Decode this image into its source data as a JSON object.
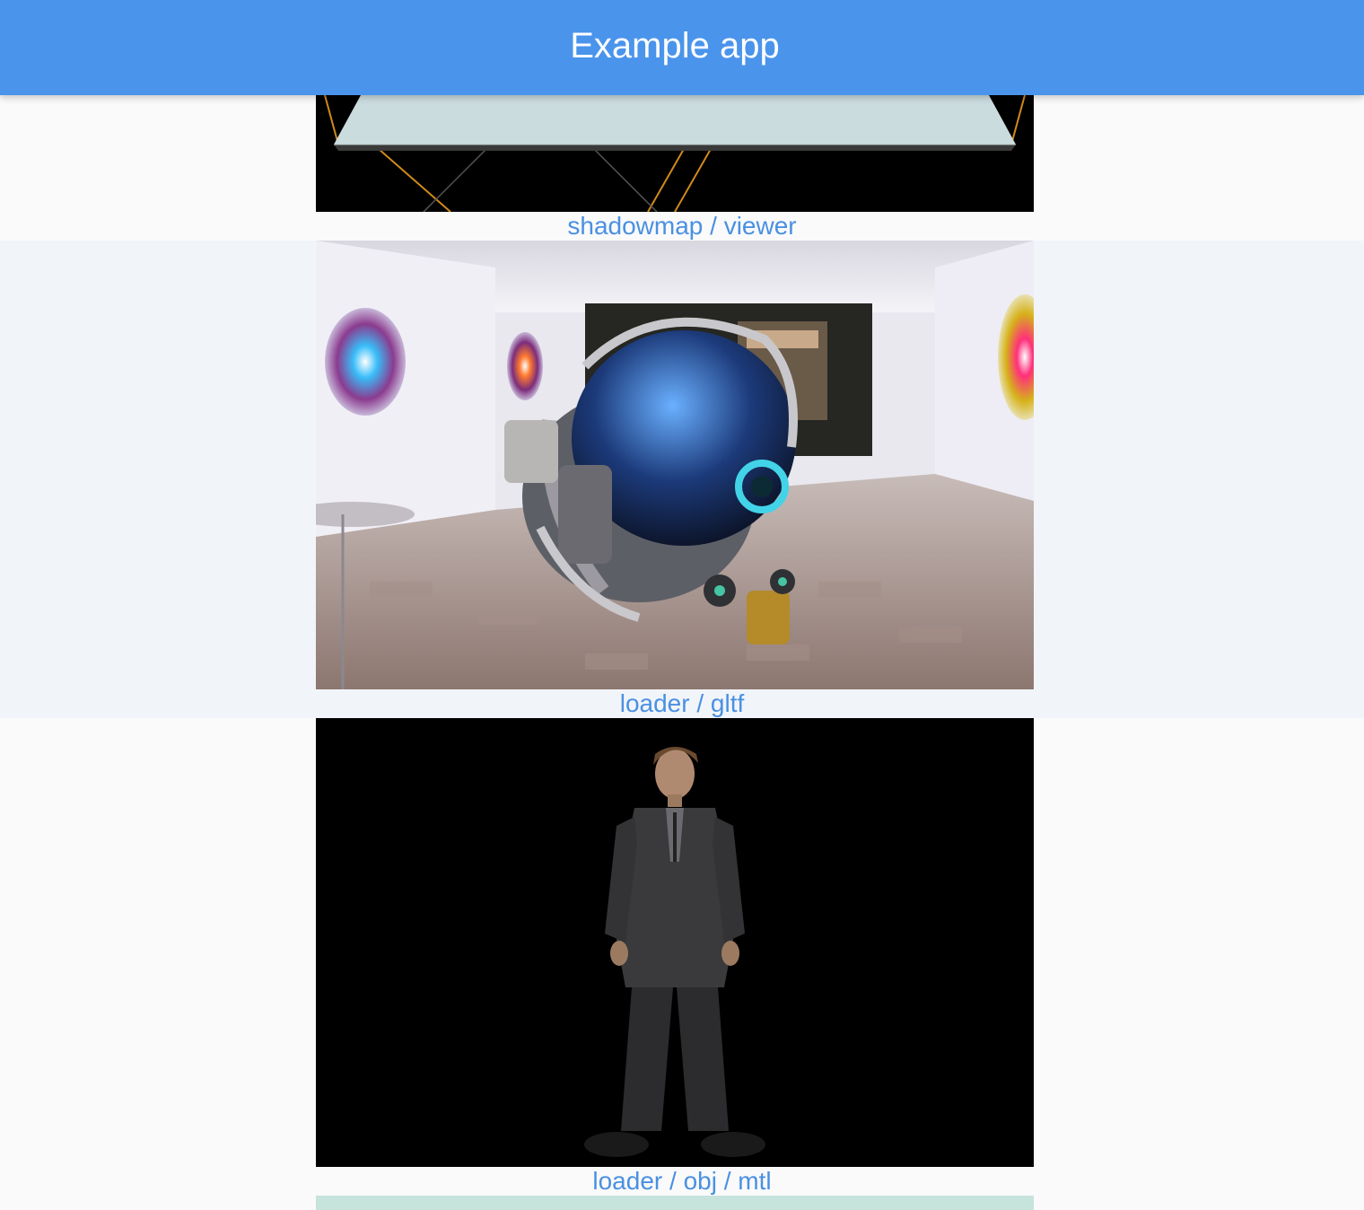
{
  "app_bar": {
    "title": "Example app"
  },
  "examples": [
    {
      "caption": "shadowmap / viewer"
    },
    {
      "caption": "loader / gltf"
    },
    {
      "caption": "loader / obj / mtl"
    }
  ],
  "colors": {
    "app_bar": "#4a94ec",
    "link": "#4a90e2",
    "background": "#fafafa",
    "alt_row": "#f1f5f9"
  }
}
